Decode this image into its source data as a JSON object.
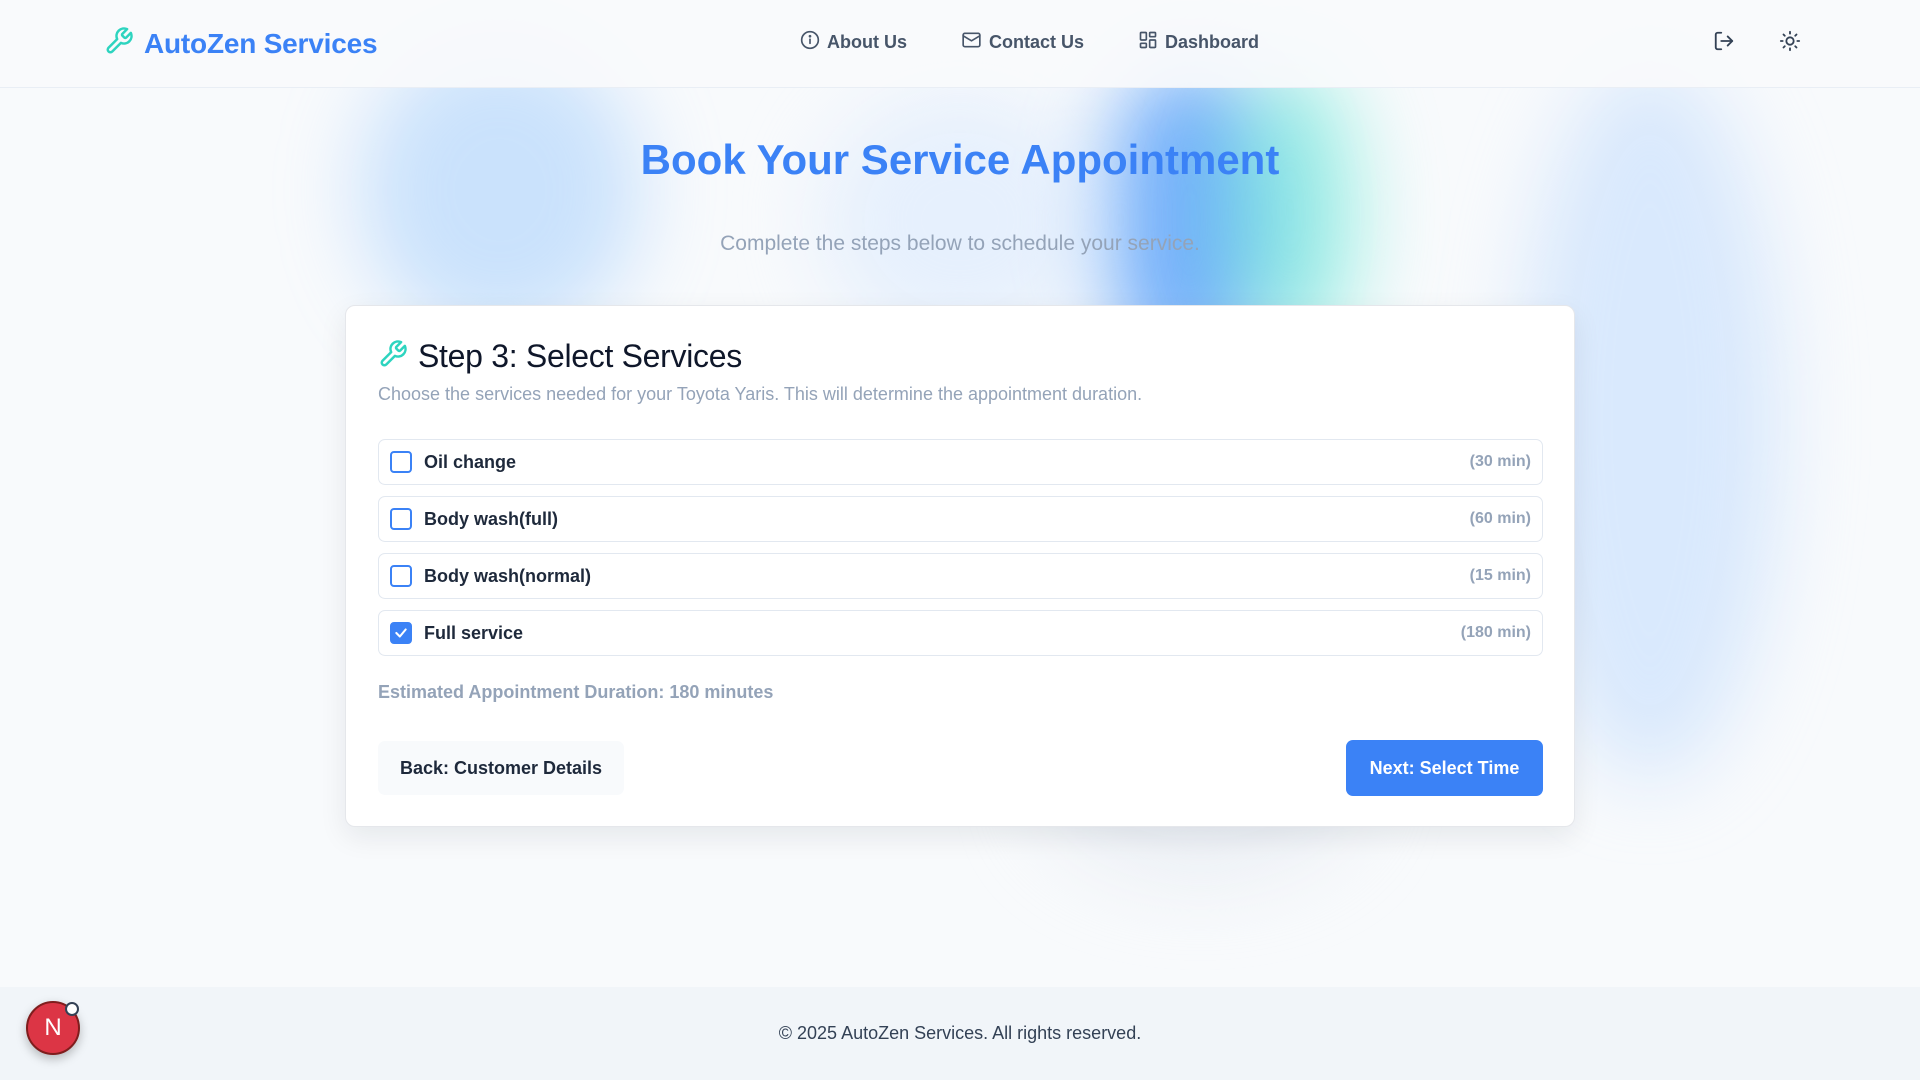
{
  "brand": {
    "name": "AutoZen Services",
    "icon": "wrench-icon"
  },
  "nav": {
    "items": [
      {
        "label": "About Us",
        "icon": "info-icon"
      },
      {
        "label": "Contact Us",
        "icon": "mail-icon"
      },
      {
        "label": "Dashboard",
        "icon": "dashboard-grid-icon"
      }
    ],
    "logout_icon": "logout-icon",
    "theme_icon": "sun-icon"
  },
  "page": {
    "title": "Book Your Service Appointment",
    "subtitle": "Complete the steps below to schedule your service."
  },
  "step": {
    "title": "Step 3: Select Services",
    "description": "Choose the services needed for your Toyota Yaris. This will determine the appointment duration.",
    "services": [
      {
        "name": "Oil change",
        "duration": "(30 min)",
        "checked": false
      },
      {
        "name": "Body wash(full)",
        "duration": "(60 min)",
        "checked": false
      },
      {
        "name": "Body wash(normal)",
        "duration": "(15 min)",
        "checked": false
      },
      {
        "name": "Full service",
        "duration": "(180 min)",
        "checked": true
      }
    ],
    "estimated_duration": "Estimated Appointment Duration: 180 minutes",
    "back_label": "Back: Customer Details",
    "next_label": "Next: Select Time"
  },
  "footer": {
    "text": "© 2025 AutoZen Services. All rights reserved."
  },
  "avatar": {
    "letter": "N"
  },
  "colors": {
    "accent": "#3b82f6",
    "teal": "#2dd4bf",
    "muted": "#94a3b8"
  }
}
